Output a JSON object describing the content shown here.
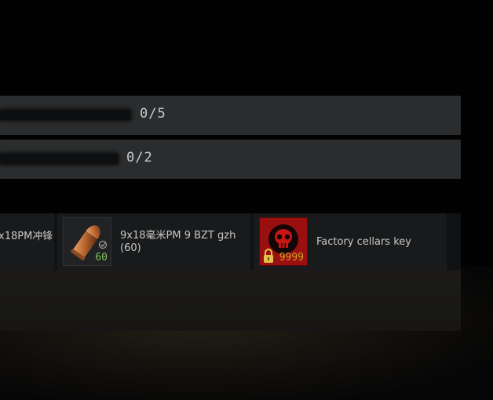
{
  "quest_progress": [
    {
      "label": "0/5",
      "fraction": 0
    },
    {
      "label": "0/2",
      "fraction": 0
    }
  ],
  "items": [
    {
      "name": "x18PM冲锋"
    },
    {
      "name": "9x18毫米PM 9 BZT gzh (60)",
      "count": "60",
      "icon": "pistol-bullet-icon",
      "badge": "check-icon",
      "count_color": "#7fbf5f"
    },
    {
      "name": "Factory cellars key",
      "count": "9999",
      "icon": "skull-key-icon",
      "badge": "lock-icon",
      "count_color": "#c9a227",
      "tile_color": "#9a1010"
    }
  ]
}
